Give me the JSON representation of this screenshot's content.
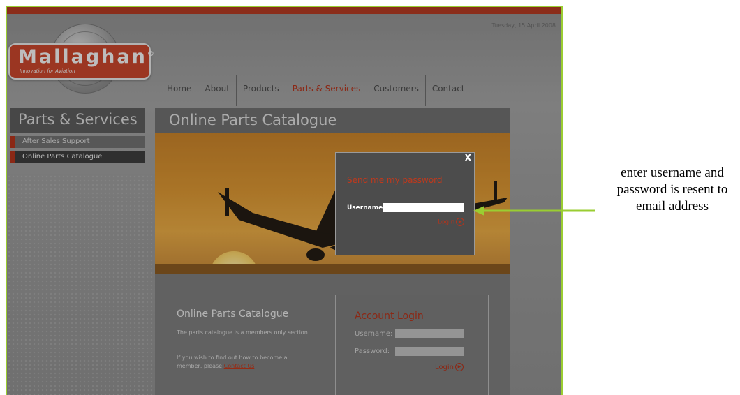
{
  "header": {
    "date": "Tuesday, 15 April 2008",
    "logo_name": "Mallaghan",
    "logo_mark": "®",
    "logo_tagline": "Innovation for Aviation"
  },
  "nav": {
    "items": [
      {
        "label": "Home"
      },
      {
        "label": "About"
      },
      {
        "label": "Products"
      },
      {
        "label": "Parts & Services",
        "active": true
      },
      {
        "label": "Customers"
      },
      {
        "label": "Contact"
      }
    ]
  },
  "sidebar": {
    "title": "Parts & Services",
    "links": [
      {
        "label": "After Sales Support"
      },
      {
        "label": "Online Parts Catalogue",
        "active": true
      }
    ]
  },
  "main": {
    "title": "Online Parts Catalogue",
    "info": {
      "title": "Online Parts Catalogue",
      "text1": "The parts catalogue is a members only section",
      "text2": "If you wish to find out how to become a member, please",
      "contact_link": "Contact Us"
    },
    "account_login": {
      "title": "Account Login",
      "username_label": "Username:",
      "password_label": "Password:",
      "login_label": "Login"
    }
  },
  "modal": {
    "close_label": "X",
    "title": "Send me my password",
    "username_label": "Username",
    "login_label": "Login"
  },
  "annotation": {
    "text": "enter username and password is resent to email address"
  },
  "colors": {
    "brand_red": "#b3341c",
    "frame_border": "#9acd32",
    "arrow": "#9acd32"
  }
}
